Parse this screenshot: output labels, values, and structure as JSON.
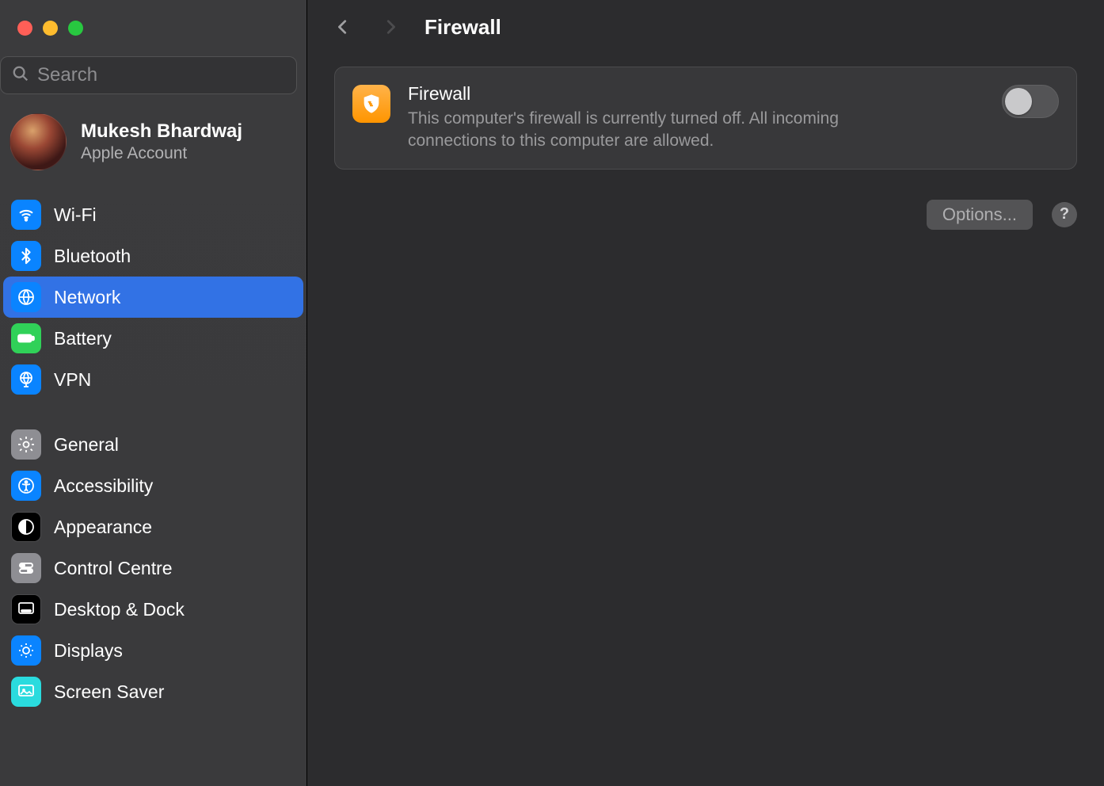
{
  "search": {
    "placeholder": "Search"
  },
  "account": {
    "name": "Mukesh Bhardwaj",
    "subtitle": "Apple Account"
  },
  "sidebar": {
    "group1": [
      {
        "label": "Wi-Fi"
      },
      {
        "label": "Bluetooth"
      },
      {
        "label": "Network"
      },
      {
        "label": "Battery"
      },
      {
        "label": "VPN"
      }
    ],
    "group2": [
      {
        "label": "General"
      },
      {
        "label": "Accessibility"
      },
      {
        "label": "Appearance"
      },
      {
        "label": "Control Centre"
      },
      {
        "label": "Desktop & Dock"
      },
      {
        "label": "Displays"
      },
      {
        "label": "Screen Saver"
      }
    ]
  },
  "page": {
    "title": "Firewall"
  },
  "firewall_panel": {
    "title": "Firewall",
    "description": "This computer's firewall is currently turned off. All incoming connections to this computer are allowed.",
    "enabled": false
  },
  "actions": {
    "options_label": "Options...",
    "help_label": "?"
  }
}
